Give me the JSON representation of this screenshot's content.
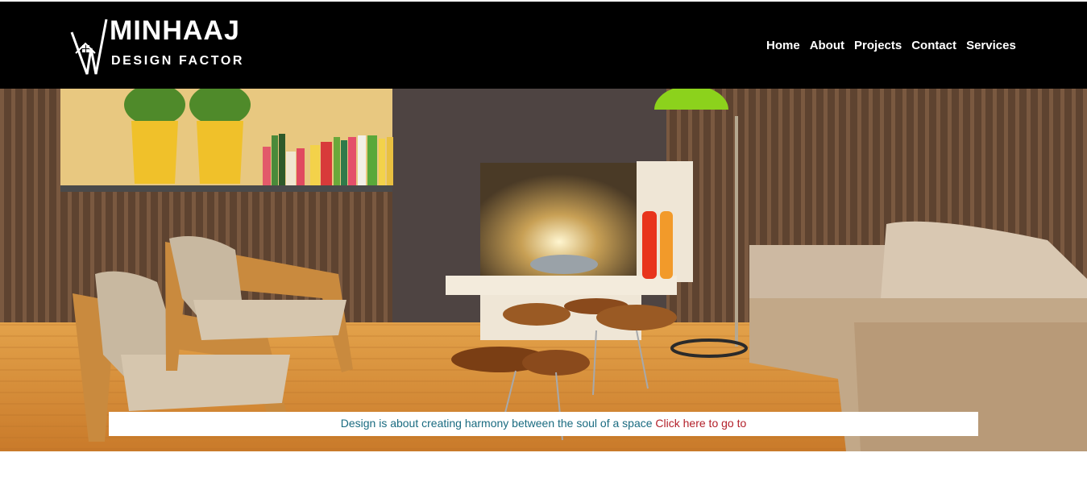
{
  "header": {
    "brand": {
      "name": "MINHAAJ",
      "tagline": "DESIGN FACTOR",
      "logo_icon": "house-monogram-icon"
    },
    "nav": [
      {
        "label": "Home"
      },
      {
        "label": "About"
      },
      {
        "label": "Projects"
      },
      {
        "label": "Contact"
      },
      {
        "label": "Services"
      }
    ]
  },
  "hero": {
    "image": "living-room-interior",
    "banner": {
      "quote": "Design is about creating harmony between the soul of a space",
      "link_text": "Click here to go to"
    }
  },
  "colors": {
    "header_bg": "#000000",
    "nav_text": "#ffffff",
    "quote_text": "#1a6b80",
    "link_text": "#b3202a"
  }
}
